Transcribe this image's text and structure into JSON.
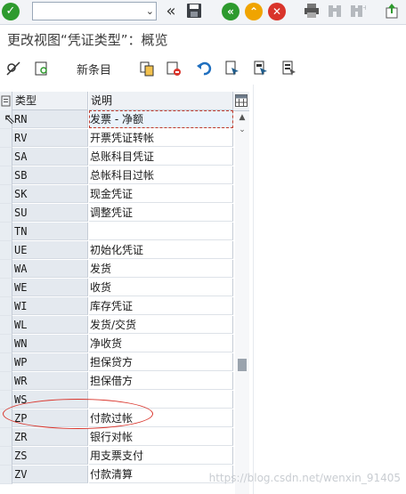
{
  "toolbar": {
    "command_value": "",
    "command_placeholder": "",
    "icons": [
      "enter-icon",
      "command-dropdown-icon",
      "collapse-icon",
      "save-icon",
      "back-icon",
      "exit-icon",
      "cancel-icon",
      "print-icon",
      "find-icon",
      "find-next-icon",
      "shortcut-icon"
    ]
  },
  "title": "更改视图“凭证类型”：概览",
  "app_toolbar": {
    "new_entries_label": "新条目"
  },
  "table": {
    "col_type": "类型",
    "col_desc": "说明",
    "rows": [
      {
        "type": "RN",
        "desc": "发票 - 净额"
      },
      {
        "type": "RV",
        "desc": "开票凭证转帐"
      },
      {
        "type": "SA",
        "desc": "总账科目凭证"
      },
      {
        "type": "SB",
        "desc": "总帐科目过帐"
      },
      {
        "type": "SK",
        "desc": "现金凭证"
      },
      {
        "type": "SU",
        "desc": "调整凭证"
      },
      {
        "type": "TN",
        "desc": ""
      },
      {
        "type": "UE",
        "desc": "初始化凭证"
      },
      {
        "type": "WA",
        "desc": "发货"
      },
      {
        "type": "WE",
        "desc": "收货"
      },
      {
        "type": "WI",
        "desc": "库存凭证"
      },
      {
        "type": "WL",
        "desc": "发货/交货"
      },
      {
        "type": "WN",
        "desc": "净收货"
      },
      {
        "type": "WP",
        "desc": "担保贷方"
      },
      {
        "type": "WR",
        "desc": "担保借方"
      },
      {
        "type": "WS",
        "desc": ""
      },
      {
        "type": "ZP",
        "desc": "付款过帐"
      },
      {
        "type": "ZR",
        "desc": "银行对帐"
      },
      {
        "type": "ZS",
        "desc": "用支票支付"
      },
      {
        "type": "ZV",
        "desc": "付款清算"
      }
    ]
  },
  "watermark": "https://blog.csdn.net/wenxin_91405"
}
